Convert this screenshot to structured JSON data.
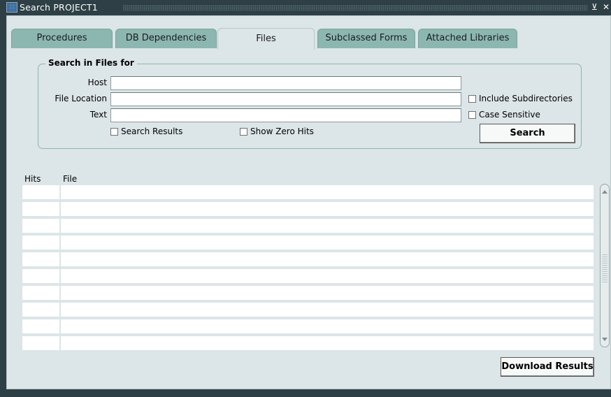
{
  "window": {
    "title": "Search PROJECT1",
    "minimize_glyph": "⊻",
    "close_glyph": "✕"
  },
  "tabs": [
    {
      "label": "Procedures"
    },
    {
      "label": "DB Dependencies"
    },
    {
      "label": "Files"
    },
    {
      "label": "Subclassed Forms"
    },
    {
      "label": "Attached Libraries"
    }
  ],
  "active_tab": "Files",
  "search_group": {
    "title": "Search in Files for",
    "host_label": "Host",
    "host_value": "",
    "file_location_label": "File Location",
    "file_location_value": "",
    "text_label": "Text",
    "text_value": "",
    "include_subdirectories_label": "Include Subdirectories",
    "case_sensitive_label": "Case Sensitive",
    "search_results_label": "Search Results",
    "show_zero_hits_label": "Show Zero Hits",
    "search_button_label": "Search"
  },
  "results": {
    "columns": [
      "Hits",
      "File"
    ],
    "rows": [
      {
        "hits": "",
        "file": ""
      },
      {
        "hits": "",
        "file": ""
      },
      {
        "hits": "",
        "file": ""
      },
      {
        "hits": "",
        "file": ""
      },
      {
        "hits": "",
        "file": ""
      },
      {
        "hits": "",
        "file": ""
      },
      {
        "hits": "",
        "file": ""
      },
      {
        "hits": "",
        "file": ""
      },
      {
        "hits": "",
        "file": ""
      },
      {
        "hits": "",
        "file": ""
      }
    ]
  },
  "download_button_label": "Download Results",
  "colors": {
    "tab": "#8cb7b1",
    "panel": "#dce5e7",
    "titlebar": "#2e4046"
  }
}
